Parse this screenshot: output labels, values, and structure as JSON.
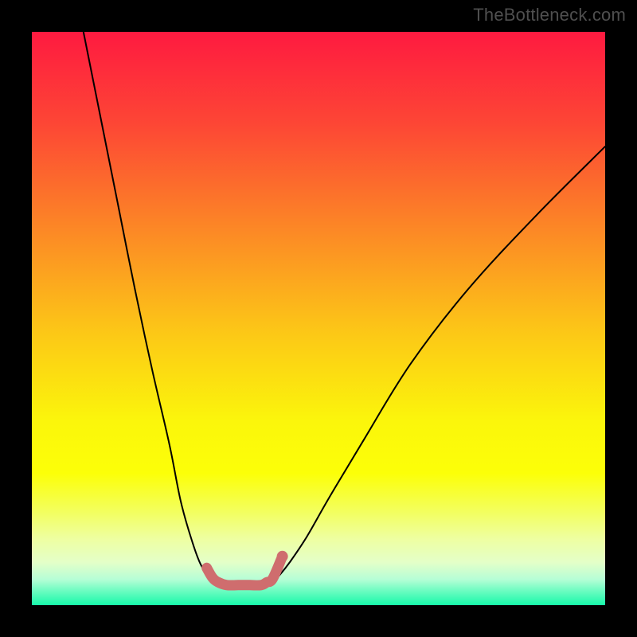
{
  "watermark": {
    "text": "TheBottleneck.com"
  },
  "colors": {
    "frame": "#000000",
    "curve": "#000000",
    "marker": "#cf6d6e",
    "gradient_stops": [
      {
        "offset": 0.0,
        "color": "#fe1a40"
      },
      {
        "offset": 0.16,
        "color": "#fd4635"
      },
      {
        "offset": 0.34,
        "color": "#fc8626"
      },
      {
        "offset": 0.52,
        "color": "#fcc617"
      },
      {
        "offset": 0.68,
        "color": "#fbf60b"
      },
      {
        "offset": 0.77,
        "color": "#fcff08"
      },
      {
        "offset": 0.835,
        "color": "#f3ff5c"
      },
      {
        "offset": 0.885,
        "color": "#eeffa2"
      },
      {
        "offset": 0.925,
        "color": "#e4ffc8"
      },
      {
        "offset": 0.955,
        "color": "#b6fed6"
      },
      {
        "offset": 0.975,
        "color": "#6cfcc1"
      },
      {
        "offset": 1.0,
        "color": "#18f9aa"
      }
    ]
  },
  "chart_data": {
    "type": "line",
    "title": "",
    "xlabel": "",
    "ylabel": "",
    "xlim": [
      0,
      100
    ],
    "ylim": [
      0,
      100
    ],
    "grid": false,
    "legend": false,
    "series": [
      {
        "name": "bottleneck-curve-left",
        "x": [
          9,
          12,
          15,
          18,
          21,
          24,
          26,
          28,
          29.5,
          31,
          32.5,
          34,
          35
        ],
        "y": [
          100,
          85,
          70,
          55,
          41,
          28,
          18,
          11,
          7,
          5,
          4,
          3.5,
          3.5
        ]
      },
      {
        "name": "bottleneck-curve-right",
        "x": [
          41,
          42,
          43,
          45,
          48,
          52,
          58,
          66,
          76,
          88,
          100
        ],
        "y": [
          3.5,
          4,
          5,
          7.5,
          12,
          19,
          29,
          42,
          55,
          68,
          80
        ]
      },
      {
        "name": "trough-marker",
        "x": [
          30.5,
          31.5,
          32.5,
          34,
          36,
          38,
          40,
          41,
          42,
          43.7
        ],
        "y": [
          6.5,
          4.8,
          4,
          3.5,
          3.5,
          3.5,
          3.5,
          4,
          4.6,
          8.5
        ]
      }
    ],
    "annotations": [
      {
        "text": "TheBottleneck.com",
        "position": "top-right"
      }
    ]
  }
}
